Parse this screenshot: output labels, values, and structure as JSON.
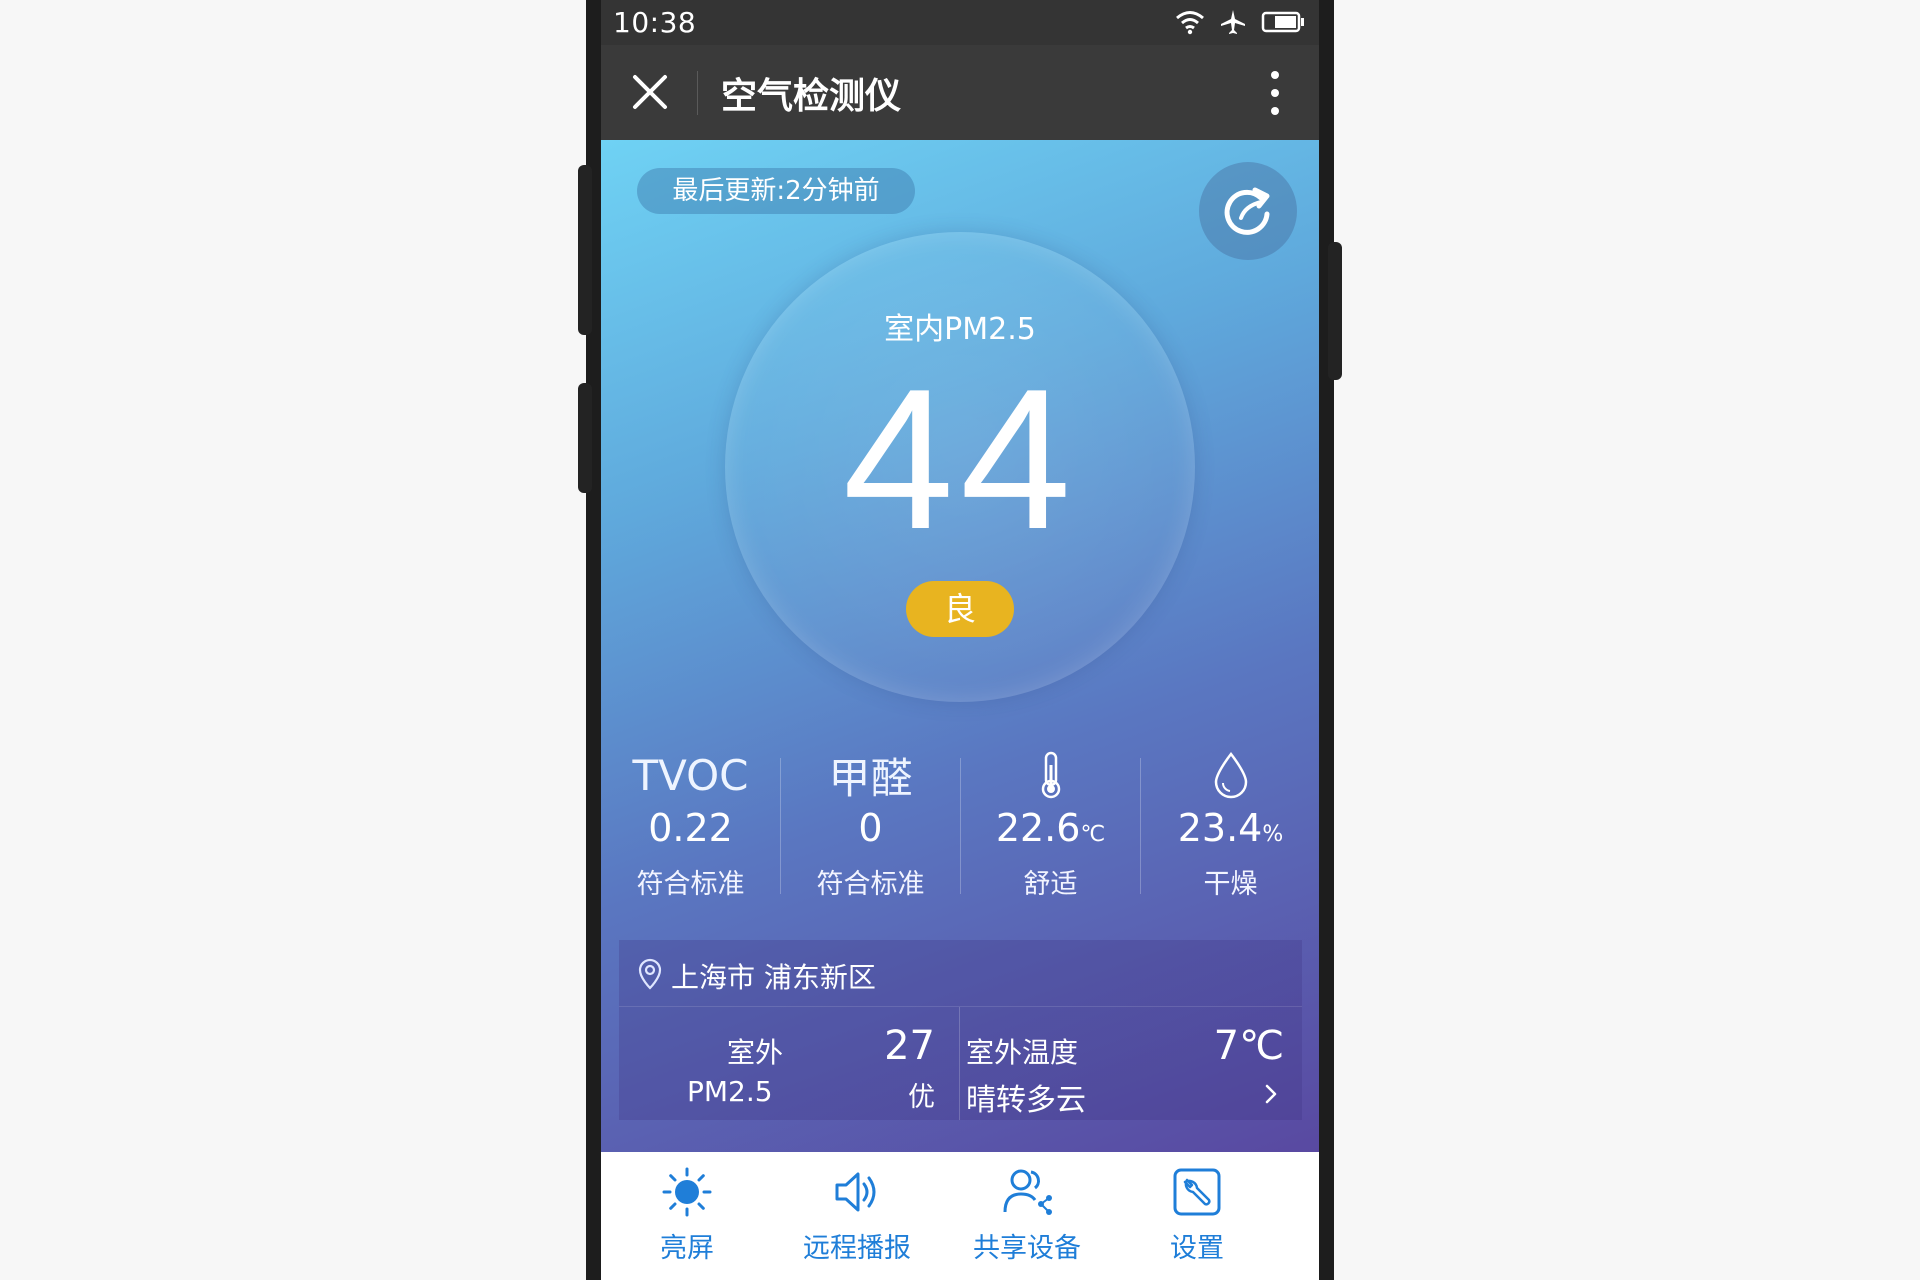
{
  "status_bar": {
    "time": "10:38"
  },
  "title_bar": {
    "title": "空气检测仪"
  },
  "main": {
    "last_update": "最后更新:2分钟前",
    "gauge_label": "室内PM2.5",
    "gauge_value": "44",
    "level": "良",
    "colors": {
      "level_pill": "#e8b420",
      "accent": "#1f7ed8"
    }
  },
  "metrics": [
    {
      "title": "TVOC",
      "value": "0.22",
      "unit": "",
      "status": "符合标准"
    },
    {
      "title": "甲醛",
      "value": "0",
      "unit": "",
      "status": "符合标准"
    },
    {
      "icon": "thermometer-icon",
      "value": "22.6",
      "unit": "℃",
      "status": "舒适"
    },
    {
      "icon": "water-drop-icon",
      "value": "23.4",
      "unit": "%",
      "status": "干燥"
    }
  ],
  "weather": {
    "location": "上海市 浦东新区",
    "outdoor_pm_label_1": "室外",
    "outdoor_pm_label_2": "PM2.5",
    "outdoor_pm_value": "27",
    "outdoor_pm_grade": "优",
    "outdoor_temp_label": "室外温度",
    "outdoor_temp_value": "7℃",
    "outdoor_condition": "晴转多云"
  },
  "bottom_nav": [
    {
      "icon": "sun-icon",
      "label": "亮屏"
    },
    {
      "icon": "speaker-icon",
      "label": "远程播报"
    },
    {
      "icon": "share-users-icon",
      "label": "共享设备"
    },
    {
      "icon": "settings-wrench-icon",
      "label": "设置"
    }
  ]
}
